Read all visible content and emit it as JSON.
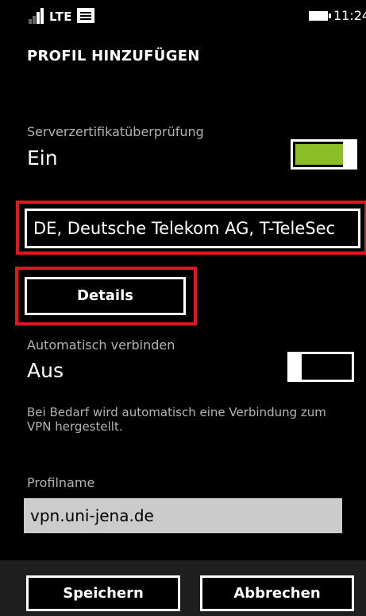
{
  "status_bar": {
    "network": "LTE",
    "time": "11:24",
    "icons": [
      "signal-icon",
      "message-icon",
      "battery-icon"
    ]
  },
  "page_title": "PROFIL HINZUFÜGEN",
  "server_cert_check": {
    "label": "Serverzertifikatüberprüfung",
    "value": "Ein",
    "toggle_on": true,
    "accent_color": "#8cbf26"
  },
  "certificate": {
    "value": "DE, Deutsche Telekom AG, T-TeleSec"
  },
  "details_button": {
    "label": "Details"
  },
  "auto_connect": {
    "label": "Automatisch verbinden",
    "value": "Aus",
    "toggle_on": false,
    "description": "Bei Bedarf wird automatisch eine Verbindung zum VPN hergestellt."
  },
  "profile_name": {
    "label": "Profilname",
    "value": "vpn.uni-jena.de"
  },
  "app_bar": {
    "save_label": "Speichern",
    "cancel_label": "Abbrechen"
  },
  "colors": {
    "background": "#000000",
    "highlight": "#e5141d",
    "app_bar": "#1f1f1f",
    "input_background": "#cccccc"
  }
}
